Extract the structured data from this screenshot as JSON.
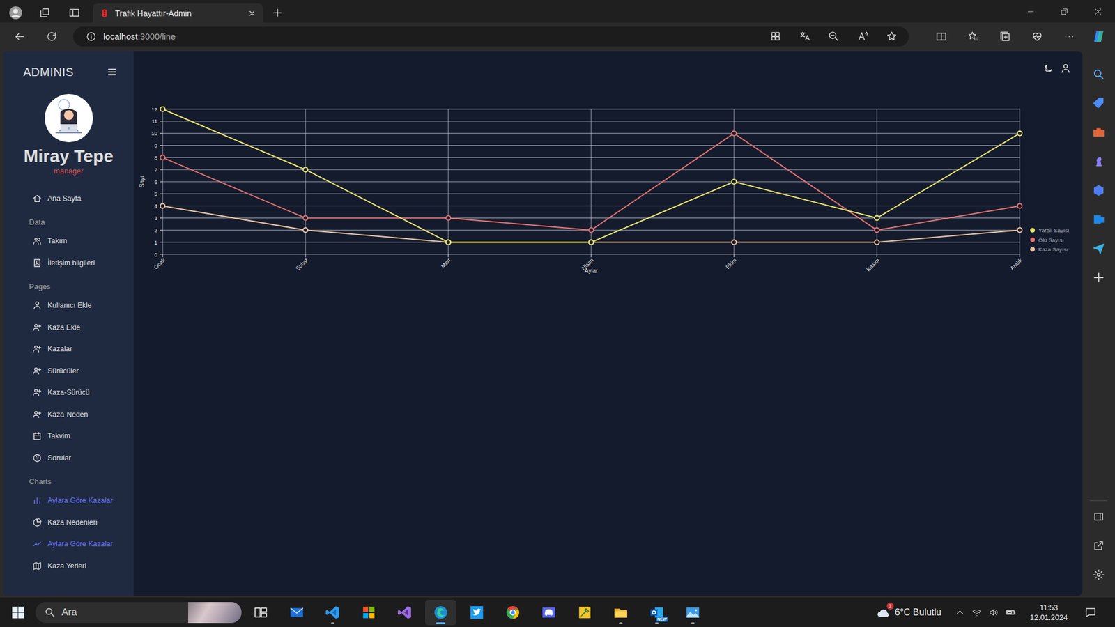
{
  "browser": {
    "tab": {
      "title": "Trafik Hayattır-Admin",
      "selected": true
    },
    "address": {
      "host": "localhost",
      "path": ":3000/line"
    }
  },
  "sidebar": {
    "brand": "ADMINIS",
    "user": {
      "name": "Miray Tepe",
      "role": "manager"
    },
    "home": {
      "kind": "home",
      "label": "Ana Sayfa",
      "selected": false
    },
    "sections": [
      {
        "title": "Data",
        "items": [
          {
            "kind": "people",
            "label": "Takım",
            "selected": false
          },
          {
            "kind": "contacts",
            "label": "İletişim bilgileri",
            "selected": false
          }
        ]
      },
      {
        "title": "Pages",
        "items": [
          {
            "kind": "person",
            "label": "Kullanıcı Ekle",
            "selected": false
          },
          {
            "kind": "group",
            "label": "Kaza Ekle",
            "selected": false
          },
          {
            "kind": "group",
            "label": "Kazalar",
            "selected": false
          },
          {
            "kind": "group",
            "label": "Sürücüler",
            "selected": false
          },
          {
            "kind": "group",
            "label": "Kaza-Sürücü",
            "selected": false
          },
          {
            "kind": "group",
            "label": "Kaza-Neden",
            "selected": false
          },
          {
            "kind": "calendar",
            "label": "Takvim",
            "selected": false
          },
          {
            "kind": "help",
            "label": "Sorular",
            "selected": false
          }
        ]
      },
      {
        "title": "Charts",
        "items": [
          {
            "kind": "bar",
            "label": "Aylara Göre Kazalar",
            "selected": true
          },
          {
            "kind": "pie",
            "label": "Kaza Nedenleri",
            "selected": false
          },
          {
            "kind": "line",
            "label": "Aylara Göre Kazalar",
            "selected": true
          },
          {
            "kind": "map",
            "label": "Kaza Yerleri",
            "selected": false
          }
        ]
      }
    ]
  },
  "chart": {
    "y_axis": {
      "title": "Sayı",
      "ticks": [
        "0",
        "1",
        "2",
        "3",
        "4",
        "5",
        "6",
        "7",
        "8",
        "9",
        "10",
        "11",
        "12"
      ]
    },
    "x_axis": {
      "title": "Aylar",
      "labels": [
        "Ocak",
        "Şubat",
        "Mart",
        "Nisan",
        "Ekim",
        "Kasım",
        "Aralık"
      ]
    },
    "series": [
      {
        "name": "Yaralı Sayısı",
        "color": "#e8e36a",
        "values": [
          12,
          7,
          1,
          1,
          6,
          3,
          10
        ]
      },
      {
        "name": "Ölü Sayısı",
        "color": "#e2726e",
        "values": [
          8,
          3,
          3,
          2,
          10,
          2,
          4
        ]
      },
      {
        "name": "Kaza Sayısı",
        "color": "#e8c1a0",
        "values": [
          4,
          2,
          1,
          1,
          1,
          1,
          2
        ]
      }
    ]
  },
  "taskbar": {
    "search": {
      "placeholder": "Ara"
    },
    "apps": [
      {
        "kind": "taskview",
        "running": false,
        "selected": false
      },
      {
        "kind": "mail",
        "running": false,
        "selected": false
      },
      {
        "kind": "vscode",
        "running": true,
        "selected": false
      },
      {
        "kind": "store",
        "running": false,
        "selected": false
      },
      {
        "kind": "visualstudio",
        "running": false,
        "selected": false
      },
      {
        "kind": "edge",
        "running": true,
        "selected": true
      },
      {
        "kind": "twitter",
        "running": false,
        "selected": false
      },
      {
        "kind": "chrome",
        "running": false,
        "selected": false
      },
      {
        "kind": "discord",
        "running": false,
        "selected": false
      },
      {
        "kind": "tool",
        "running": false,
        "selected": false
      },
      {
        "kind": "explorer",
        "running": true,
        "selected": false
      },
      {
        "kind": "outlook",
        "running": true,
        "selected": false,
        "badge": "NEW"
      },
      {
        "kind": "photos",
        "running": true,
        "selected": false
      }
    ],
    "weather": {
      "reading": "6°C Bulutlu",
      "badge": "1"
    },
    "clock": {
      "time": "11:53",
      "date": "12.01.2024"
    }
  }
}
